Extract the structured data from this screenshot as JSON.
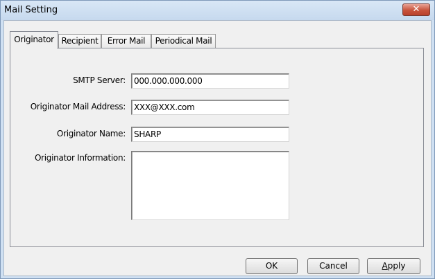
{
  "window": {
    "title": "Mail Setting",
    "close_label": "✕"
  },
  "tabs": [
    {
      "label": "Originator",
      "active": true
    },
    {
      "label": "Recipient",
      "active": false
    },
    {
      "label": "Error Mail",
      "active": false
    },
    {
      "label": "Periodical Mail",
      "active": false
    }
  ],
  "form": {
    "smtp_server": {
      "label": "SMTP Server:",
      "value": "000.000.000.000"
    },
    "originator_mail_address": {
      "label": "Originator Mail Address:",
      "value": "XXX@XXX.com"
    },
    "originator_name": {
      "label": "Originator Name:",
      "value": "SHARP"
    },
    "originator_information": {
      "label": "Originator Information:",
      "value": ""
    }
  },
  "buttons": {
    "ok": "OK",
    "cancel": "Cancel",
    "apply_first": "A",
    "apply_rest": "pply"
  }
}
